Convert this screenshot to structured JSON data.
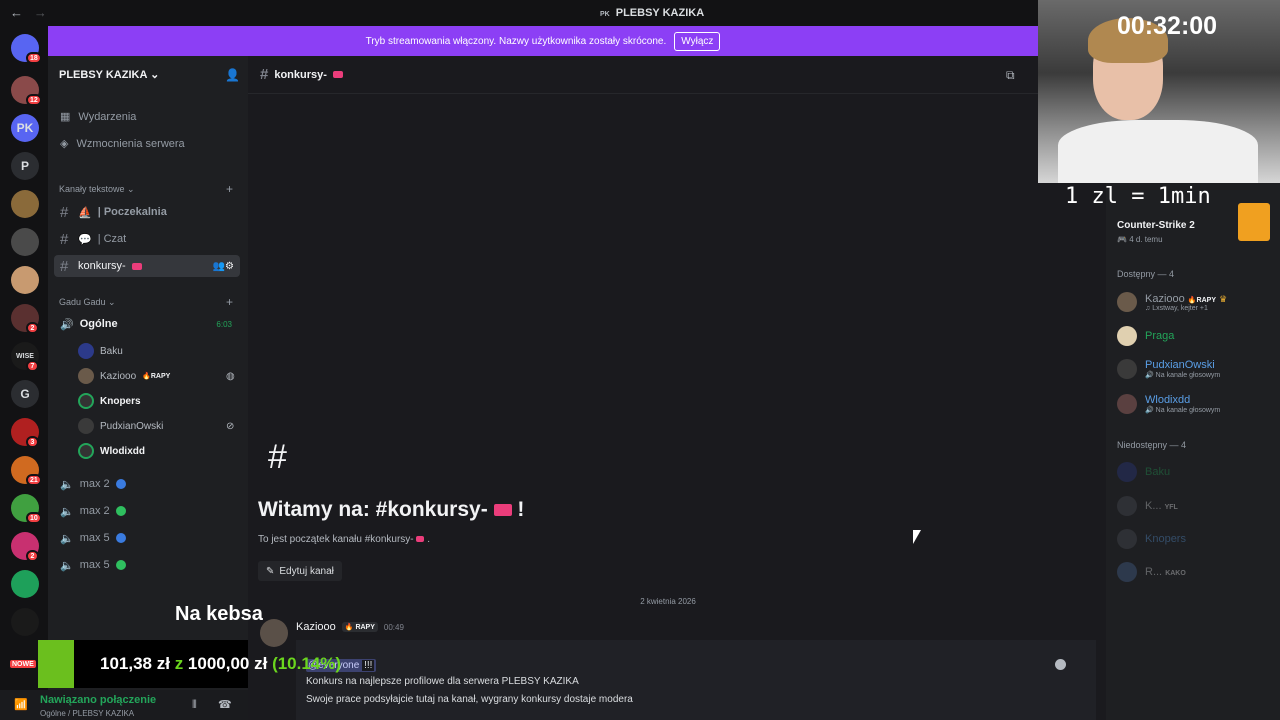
{
  "titlebar": {
    "back": "←",
    "forward": "→",
    "server_tag": "PK",
    "title": "PLEBSY KAZIKA"
  },
  "rail": {
    "servers": [
      {
        "label": "",
        "badge": "18"
      },
      {
        "label": "",
        "badge": "12"
      },
      {
        "label": "PK",
        "badge": ""
      },
      {
        "label": "P",
        "badge": ""
      },
      {
        "label": "",
        "badge": ""
      },
      {
        "label": "",
        "badge": ""
      },
      {
        "label": "",
        "badge": ""
      },
      {
        "label": "",
        "badge": "2"
      },
      {
        "label": "WISE",
        "badge": "7"
      },
      {
        "label": "G",
        "badge": ""
      },
      {
        "label": "",
        "badge": "3"
      },
      {
        "label": "",
        "badge": "21"
      },
      {
        "label": "",
        "badge": "10"
      },
      {
        "label": "",
        "badge": "2"
      },
      {
        "label": "",
        "badge": ""
      },
      {
        "label": "",
        "badge": ""
      }
    ],
    "new_badge": "NOWE"
  },
  "banner": {
    "text": "Tryb streamowania włączony. Nazwy użytkownika zostały skrócone.",
    "button": "Wyłącz"
  },
  "sidebar": {
    "server_name": "PLEBSY KAZIKA",
    "events": "Wydarzenia",
    "boosts": "Wzmocnienia serwera",
    "text_category": "Kanały tekstowe",
    "text_channels": [
      {
        "name": "| Poczekalnia"
      },
      {
        "name": "| Czat"
      },
      {
        "name": "konkursy-"
      }
    ],
    "voice_category": "Gadu Gadu",
    "voice_main": {
      "name": "Ogólne",
      "time": "6:03"
    },
    "voice_users": [
      {
        "name": "Baku",
        "tag": ""
      },
      {
        "name": "Kaziooo",
        "tag": "RAPY"
      },
      {
        "name": "Knopers",
        "tag": ""
      },
      {
        "name": "PudxianOwski",
        "tag": ""
      },
      {
        "name": "Wlodixdd",
        "tag": ""
      }
    ],
    "voice_channels": [
      {
        "name": "max 2",
        "dot_color": "#3a7be0"
      },
      {
        "name": "max 2",
        "dot_color": "#2fbf5f"
      },
      {
        "name": "max 5",
        "dot_color": "#3a7be0"
      },
      {
        "name": "max 5",
        "dot_color": "#2fbf5f"
      }
    ],
    "connection": {
      "status": "Nawiązano połączenie",
      "location": "Ogólne / PLEBSY KAZIKA"
    }
  },
  "main": {
    "channel": "konkursy-",
    "welcome_title": "Witamy na: #konkursy-",
    "welcome_title_end": "!",
    "welcome_sub": "To jest początek kanału #konkursy-",
    "edit_button": "Edytuj kanał",
    "date_divider": "2 kwietnia 2026",
    "message": {
      "author": "Kaziooo",
      "tag": "RAPY",
      "time": "00:49",
      "mention": "@everyone",
      "exclaim": "!!!",
      "line1": "Konkurs na najlepsze profilowe dla serwera PLEBSY KAZIKA",
      "line2": "Swoje prace podsyłajcie tutaj na kanał, wygrany konkursy dostaje modera"
    }
  },
  "members": {
    "activity": {
      "title": "Counter-Strike 2",
      "sub": "4 d. temu"
    },
    "online_header": "Dostępny — 4",
    "online": [
      {
        "name": "Kaziooo",
        "tag": "RAPY",
        "sub": "Lxstway, kejter +1",
        "color": "#949ba4"
      },
      {
        "name": "Praga",
        "tag": "",
        "sub": "",
        "color": "#23a55a"
      },
      {
        "name": "PudxianOwski",
        "tag": "",
        "sub": "Na kanale głosowym",
        "color": "#5a9ee6"
      },
      {
        "name": "Wlodixdd",
        "tag": "",
        "sub": "Na kanale głosowym",
        "color": "#5a9ee6"
      }
    ],
    "offline_header": "Niedostępny — 4",
    "offline": [
      {
        "name": "Baku",
        "tag": ""
      },
      {
        "name": "K...",
        "tag": "YFL"
      },
      {
        "name": "Knopers",
        "tag": ""
      },
      {
        "name": "R...",
        "tag": "KAKO"
      }
    ]
  },
  "overlay": {
    "timer": "00:32:00",
    "rate": "1 zl = 1min",
    "caption": "Na kebsa",
    "goal_current": "101,38 zł",
    "goal_sep": "z",
    "goal_target": "1000,00 zł",
    "goal_pct": "(10.14%)"
  }
}
